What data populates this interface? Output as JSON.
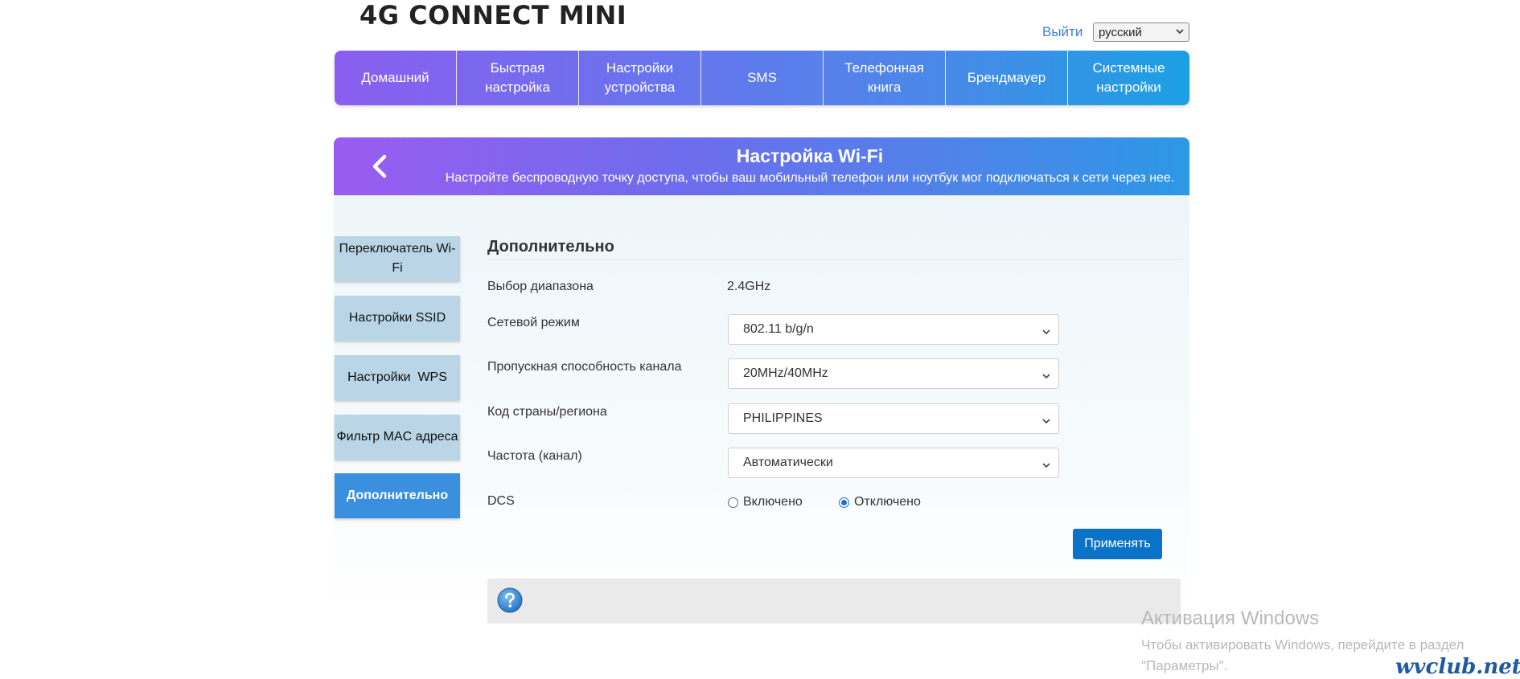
{
  "header": {
    "brand": "4G CONNECT MINI",
    "logout_label": "Выйти",
    "language_selected": "русский"
  },
  "topnav": {
    "items": [
      {
        "label": "Домашний"
      },
      {
        "label": "Быстрая настройка"
      },
      {
        "label": "Настройки устройства"
      },
      {
        "label": "SMS"
      },
      {
        "label": "Телефонная книга"
      },
      {
        "label": "Брендмауер"
      },
      {
        "label": "Системные настройки"
      }
    ]
  },
  "panel": {
    "title": "Настройка Wi-Fi",
    "subtitle": "Настройте беспроводную точку доступа, чтобы ваш мобильный телефон или ноутбук мог подключаться к сети через нее."
  },
  "sidebar": {
    "items": [
      {
        "label": "Переключатель Wi-Fi"
      },
      {
        "label": "Настройки SSID"
      },
      {
        "label": "Настройки  WPS"
      },
      {
        "label": "Фильтр MAC адреса"
      },
      {
        "label": "Дополнительно"
      }
    ],
    "active_index": 4
  },
  "content": {
    "section_title": "Дополнительно",
    "band_label": "Выбор диапазона",
    "band_value": "2.4GHz",
    "network_mode_label": "Сетевой режим",
    "network_mode_value": "802.11 b/g/n",
    "bandwidth_label": "Пропускная способность канала",
    "bandwidth_value": "20MHz/40MHz",
    "country_label": "Код страны/региона",
    "country_value": "PHILIPPINES",
    "channel_label": "Частота (канал)",
    "channel_value": "Автоматически",
    "dcs_label": "DCS",
    "dcs_on_label": "Включено",
    "dcs_off_label": "Отключено",
    "dcs_selected": "off",
    "apply_label": "Применять"
  },
  "watermark": {
    "windows_title": "Активация Windows",
    "windows_sub": "Чтобы активировать Windows, перейдите в раздел \"Параметры\".",
    "site": "wvclub.net"
  },
  "colors": {
    "nav_gradient_start": "#8a5ef0",
    "nav_gradient_end": "#1ba0e3",
    "sidebar_item": "#b9d5e6",
    "sidebar_active": "#3a8fdf",
    "apply_button": "#0a73c8"
  },
  "icons": {
    "back": "chevron-left-icon",
    "help": "question-circle-icon",
    "dropdown": "chevron-down-icon"
  }
}
